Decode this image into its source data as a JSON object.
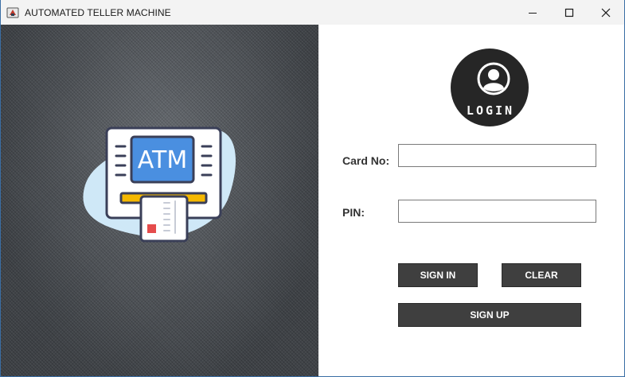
{
  "window": {
    "title": "AUTOMATED TELLER MACHINE"
  },
  "illustration": {
    "screen_text": "ATM"
  },
  "login_badge": {
    "text": "LOGIN"
  },
  "form": {
    "card_label": "Card No:",
    "card_value": "",
    "pin_label": "PIN:",
    "pin_value": ""
  },
  "buttons": {
    "sign_in": "SIGN IN",
    "clear": "CLEAR",
    "sign_up": "SIGN UP"
  },
  "colors": {
    "button_bg": "#3f3f3f",
    "atm_screen": "#4a8fe0",
    "atm_accent": "#f5b800",
    "badge_bg": "#262626"
  }
}
